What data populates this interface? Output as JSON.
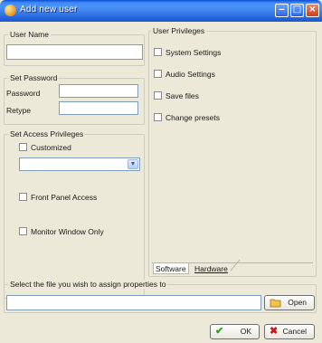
{
  "window": {
    "title": "Add new user",
    "minimize_icon": "minimize-icon",
    "maximize_icon": "maximize-icon",
    "close_icon": "close-icon"
  },
  "user_name": {
    "group_label": "User Name",
    "value": ""
  },
  "set_password": {
    "group_label": "Set Password",
    "password_label": "Password",
    "retype_label": "Retype",
    "password_value": "",
    "retype_value": ""
  },
  "access": {
    "group_label": "Set Access Privileges",
    "customized_label": "Customized",
    "customized_checked": false,
    "dropdown_value": "",
    "front_panel_label": "Front Panel Access",
    "front_panel_checked": false,
    "monitor_label": "Monitor Window Only",
    "monitor_checked": false
  },
  "user_privileges": {
    "group_label": "User Privileges",
    "items": [
      {
        "label": "System Settings",
        "checked": false
      },
      {
        "label": "Audio Settings",
        "checked": false
      },
      {
        "label": "Save files",
        "checked": false
      },
      {
        "label": "Change presets",
        "checked": false
      }
    ],
    "tabs": [
      {
        "label": "Software",
        "active": true
      },
      {
        "label": "Hardware",
        "active": false
      }
    ]
  },
  "file_select": {
    "group_label": "Select the file you wish to assign properties to",
    "path_value": "",
    "open_label": "Open",
    "open_icon": "folder-icon"
  },
  "buttons": {
    "ok_label": "OK",
    "ok_icon": "checkmark-icon",
    "cancel_label": "Cancel",
    "cancel_icon": "cross-icon"
  },
  "colors": {
    "title_bar": "#2f6ee0",
    "window_bg": "#ece9d8",
    "ok_check": "#2fa01a",
    "cancel_x": "#d01818",
    "folder": "#f2c14e"
  }
}
